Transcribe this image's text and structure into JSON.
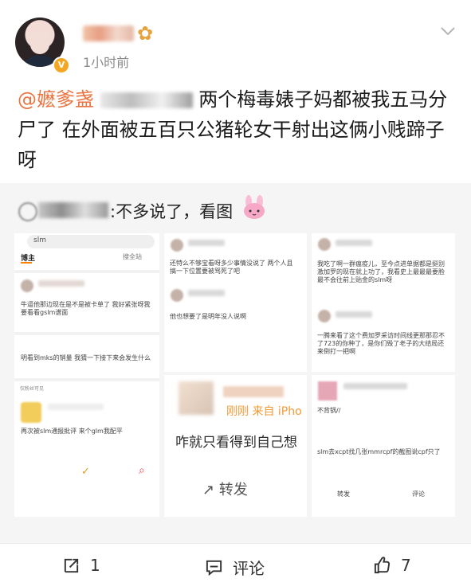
{
  "post": {
    "time": "1小时前",
    "mention": "@嬷爹盏",
    "text_after_blur": "两个梅毒婊子妈都被我五马分尸了 在外面被五百只公猪轮女干射出这俩小贱蹄子呀"
  },
  "repost": {
    "text": ":不多说了，看图"
  },
  "thumbnails": {
    "search_query": "slm",
    "tab_blogger": "博主",
    "search_all": "搜全站",
    "item_1": "牛逼他那边现在是不是被卡单了 我好紧张呀我要看看gslm谱面",
    "item_2": "明看到mks的销量 我猜一下接下来会发生什么",
    "item_3": "再次被slm通报批评",
    "item_4": "来个glm我配平",
    "tab_me": "仅粉丝可见",
    "reply_1": "还特么不够宝看呀多少事情没说了 两个人且搞一下位置要被骂死了吧",
    "reply_2": "他也想要了是明年没人说啊",
    "post_text": "咋就只看得到自己想",
    "repost_label": "转发",
    "from_device": "刚刚 来自 iPho",
    "right_1": "我吃了啊一群瘟疫儿，至今点进单据都是挺别激加罗的现在就上功了，我看史上最最最要脸最不会往前上贴金的slm呀",
    "right_2": "一腾来看了这个费加罗采访时间线更那那忍不了723的你种了，是你们毁了老子的大结局还来倒打一把啊",
    "right_3": "不背锅//",
    "right_4": "slm去xcpt找几张mmrcpf的截图说cpf只了",
    "right_footer_share": "转发",
    "right_footer_comment": "评论"
  },
  "footer": {
    "share_count": "1",
    "comment_label": "评论",
    "like_count": "7"
  },
  "icons": {
    "menu": "chevron-down-icon",
    "rabbit": "rabbit-emoji-icon",
    "share": "share-icon",
    "comment": "comment-icon",
    "like": "thumb-up-icon"
  },
  "colors": {
    "mention": "#eb7340",
    "footer_text": "#333333",
    "repost_background": "#f5f5f5",
    "accent": "#ff8200"
  }
}
